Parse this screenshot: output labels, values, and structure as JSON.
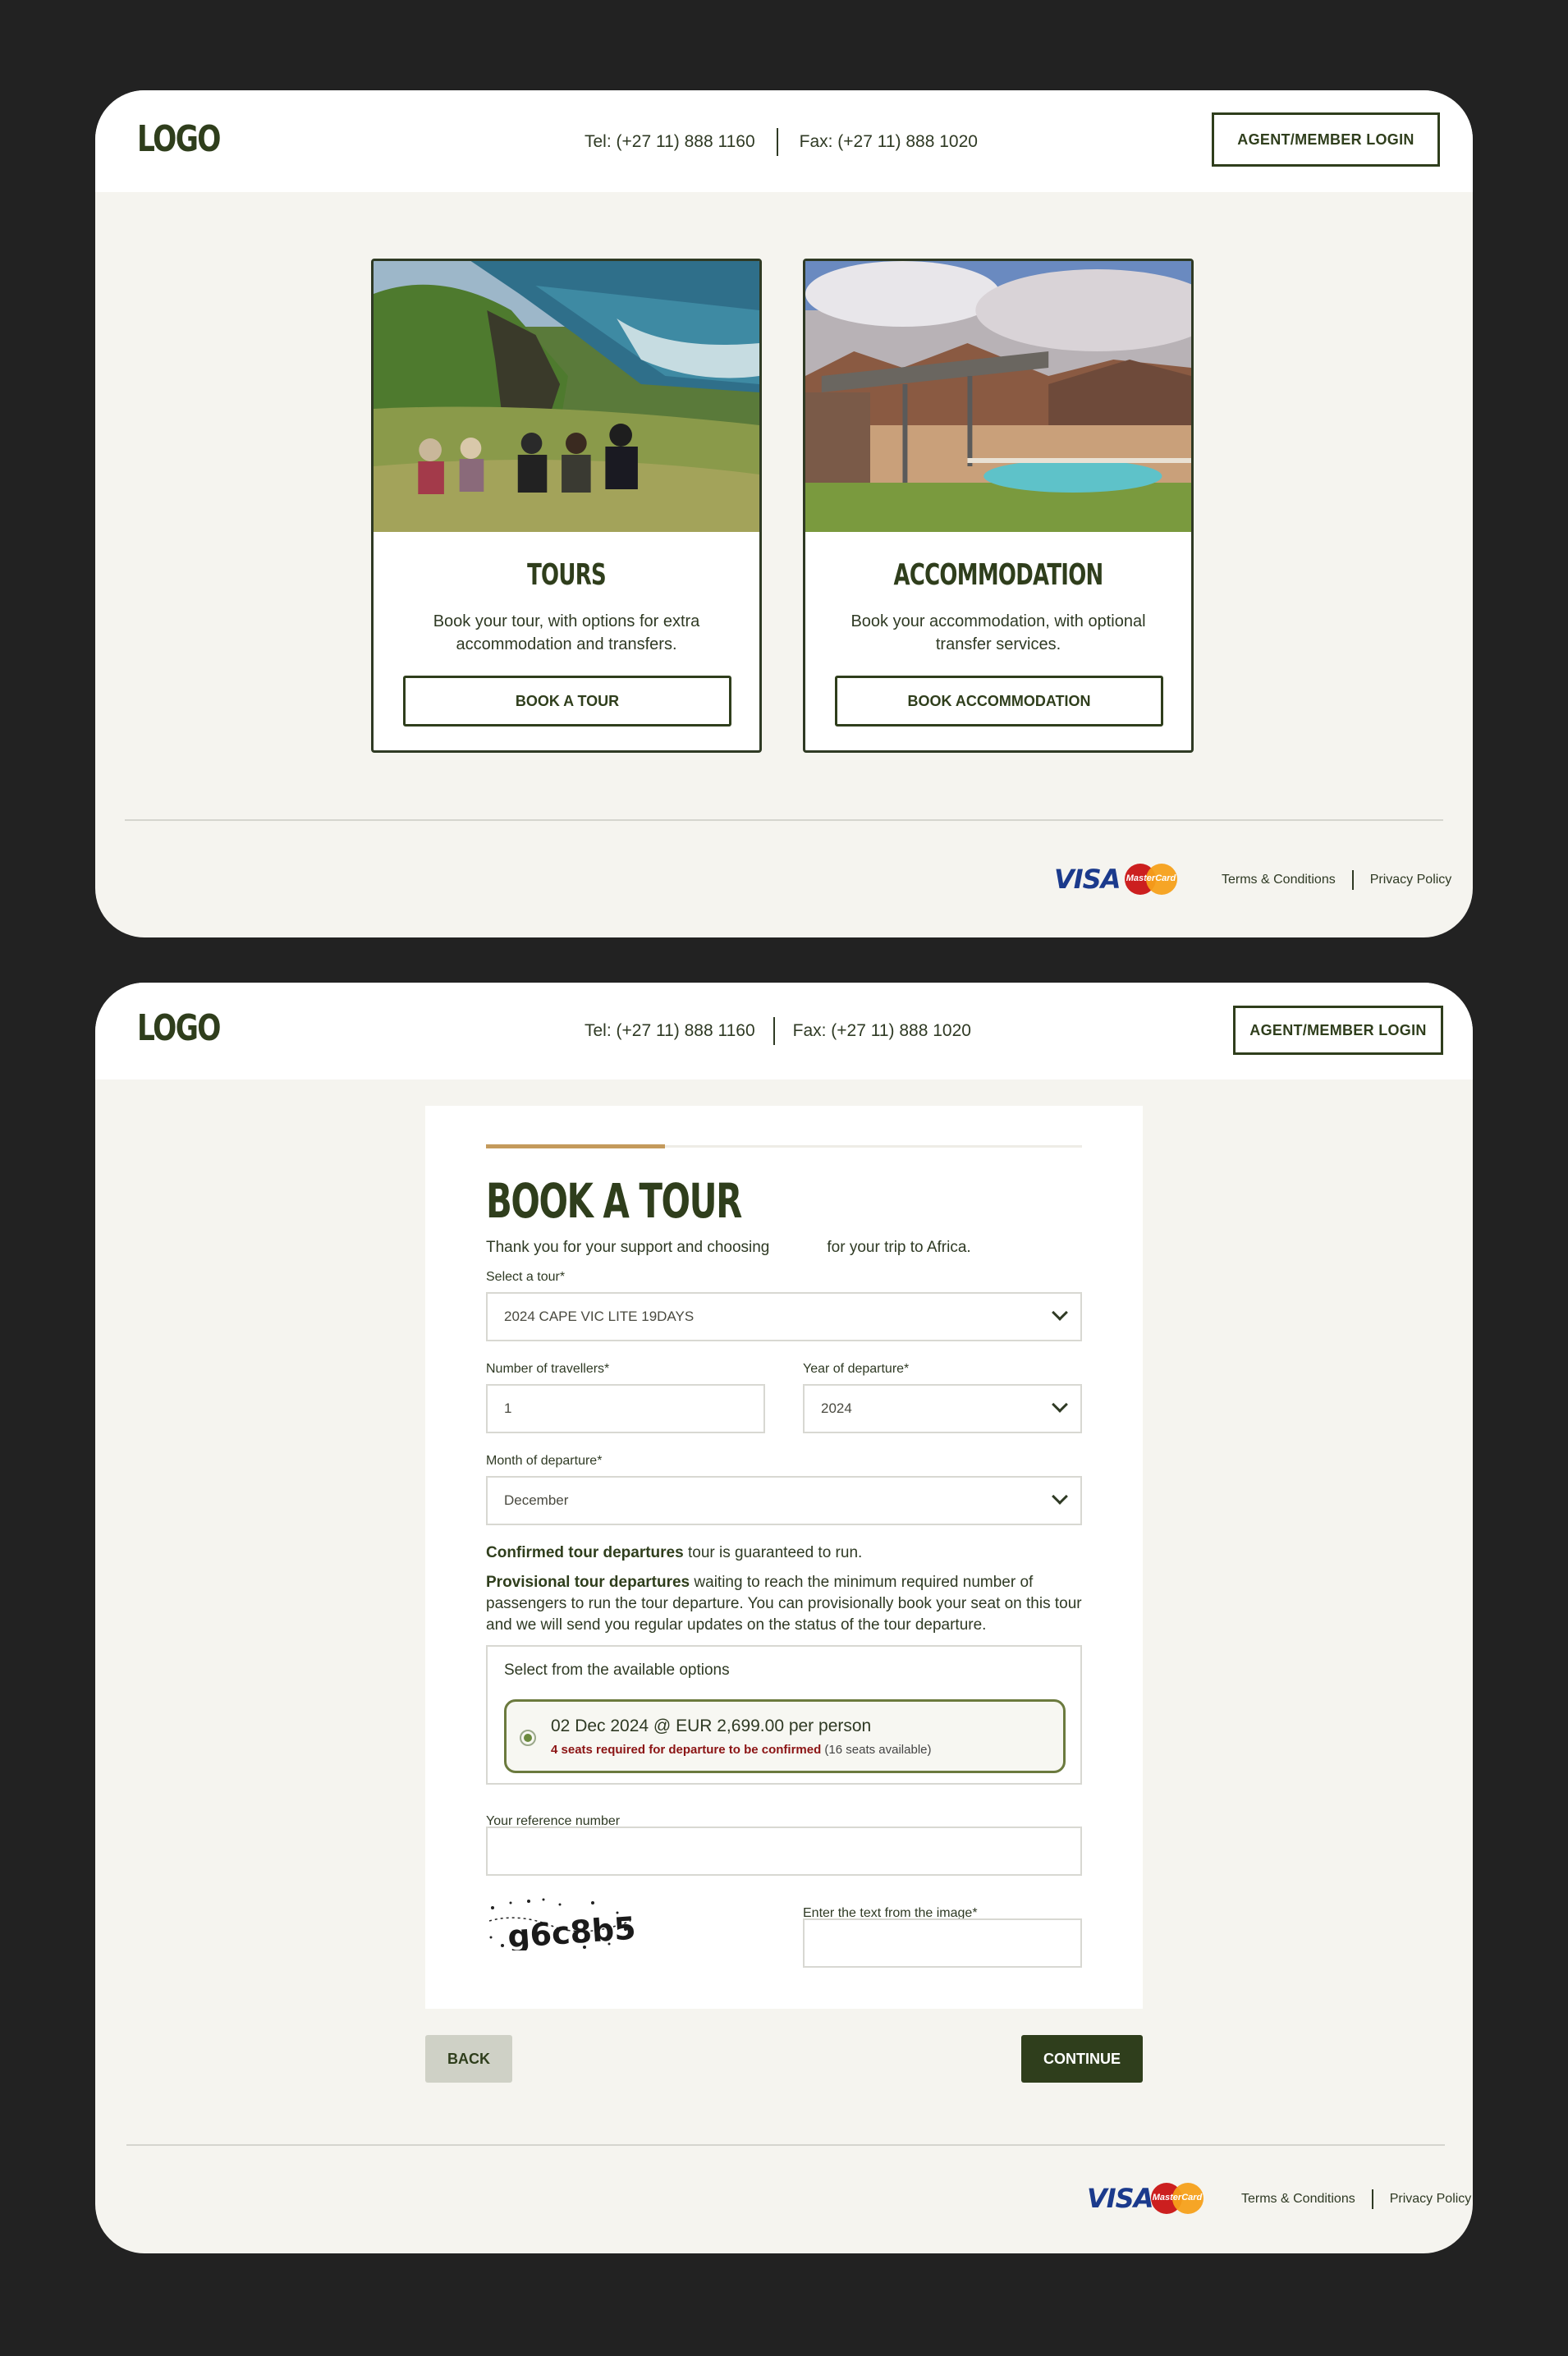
{
  "header": {
    "logo": "LOGO",
    "tel": "Tel: (+27 11) 888 1160",
    "fax": "Fax: (+27 11) 888 1020",
    "login_label": "AGENT/MEMBER LOGIN"
  },
  "cards": [
    {
      "title": "TOURS",
      "description": "Book your tour, with options for extra accommodation and transfers.",
      "button": "BOOK A TOUR",
      "photo": "coastal-hikers-photo"
    },
    {
      "title": "ACCOMMODATION",
      "description": "Book your accommodation, with optional transfer services.",
      "button": "BOOK ACCOMMODATION",
      "photo": "desert-lodge-pool-photo"
    }
  ],
  "footer": {
    "visa": "VISA",
    "mastercard": "MasterCard",
    "terms": "Terms & Conditions",
    "privacy": "Privacy Policy"
  },
  "form": {
    "title": "BOOK A TOUR",
    "progress": 0.3,
    "intro_before": "Thank you for your support and choosing",
    "intro_after": "for your trip to Africa.",
    "select_tour_label": "Select a tour*",
    "select_tour_value": "2024 CAPE VIC LITE 19DAYS",
    "travellers_label": "Number of travellers*",
    "travellers_value": "1",
    "year_label": "Year of departure*",
    "year_value": "2024",
    "month_label": "Month of departure*",
    "month_value": "December",
    "confirmed_bold": "Confirmed tour departures",
    "confirmed_rest": " tour is guaranteed to run.",
    "provisional_bold": "Provisional tour departures",
    "provisional_rest": " waiting to reach the minimum required number of passengers to run the tour departure. You can provisionally book your seat on this tour and we will send you regular updates on the status of the tour departure.",
    "options_title": "Select from the available options",
    "option": {
      "date_price": "02 Dec 2024 @ EUR 2,699.00 per person",
      "required": "4 seats required for departure to be confirmed",
      "available": " (16 seats available)",
      "selected": true
    },
    "reference_label": "Your reference number",
    "reference_value": "",
    "captcha_text": "g6c8b5",
    "captcha_label": "Enter the text from the image*",
    "captcha_value": "",
    "back_label": "BACK",
    "continue_label": "CONTINUE"
  },
  "colors": {
    "brand_green": "#2f3e1c",
    "progress_gold": "#c49a5c",
    "alert_red": "#8b1414",
    "panel_bg": "#f5f4ef"
  }
}
